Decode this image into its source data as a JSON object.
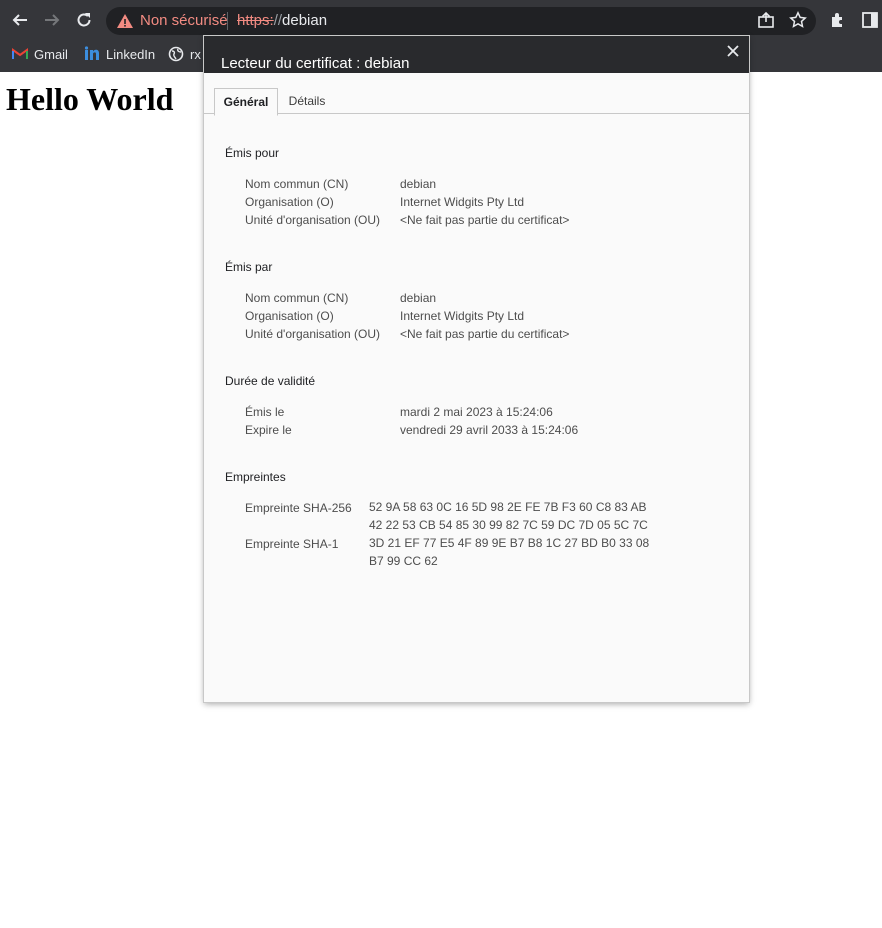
{
  "browser": {
    "security_label": "Non sécurisé",
    "url_scheme": "https:",
    "url_sep": "//",
    "url_host": "debian",
    "bookmarks": [
      {
        "label": "Gmail"
      },
      {
        "label": "LinkedIn"
      },
      {
        "label": "rx"
      }
    ]
  },
  "page": {
    "heading": "Hello World"
  },
  "dialog": {
    "title": "Lecteur du certificat : debian",
    "tabs": [
      {
        "label": "Général"
      },
      {
        "label": "Détails"
      }
    ],
    "issued_to": {
      "heading": "Émis pour",
      "rows": [
        {
          "label": "Nom commun (CN)",
          "value": "debian"
        },
        {
          "label": "Organisation (O)",
          "value": "Internet Widgits Pty Ltd"
        },
        {
          "label": "Unité d'organisation (OU)",
          "value": "<Ne fait pas partie du certificat>"
        }
      ]
    },
    "issued_by": {
      "heading": "Émis par",
      "rows": [
        {
          "label": "Nom commun (CN)",
          "value": "debian"
        },
        {
          "label": "Organisation (O)",
          "value": "Internet Widgits Pty Ltd"
        },
        {
          "label": "Unité d'organisation (OU)",
          "value": "<Ne fait pas partie du certificat>"
        }
      ]
    },
    "validity": {
      "heading": "Durée de validité",
      "rows": [
        {
          "label": "Émis le",
          "value": "mardi 2 mai 2023 à 15:24:06"
        },
        {
          "label": "Expire le",
          "value": "vendredi 29 avril 2033 à 15:24:06"
        }
      ]
    },
    "fingerprints": {
      "heading": "Empreintes",
      "rows": [
        {
          "label": "Empreinte SHA-256",
          "line1": "52 9A 58 63 0C 16 5D 98 2E FE 7B F3 60 C8 83 AB",
          "line2": "42 22 53 CB 54 85 30 99 82 7C 59 DC 7D 05 5C 7C"
        },
        {
          "label": "Empreinte SHA-1",
          "line1": "3D 21 EF 77 E5 4F 89 9E B7 B8 1C 27 BD B0 33 08",
          "line2": "B7 99 CC 62"
        }
      ]
    }
  },
  "colors": {
    "chrome_bg": "#35363a",
    "dialog_header": "#292a2d",
    "insecure_red": "#f28b82"
  }
}
